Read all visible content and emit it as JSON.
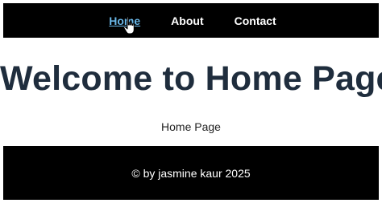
{
  "nav": {
    "items": [
      {
        "label": "Home"
      },
      {
        "label": "About"
      },
      {
        "label": "Contact"
      }
    ],
    "active_color": "#6ab7e8",
    "background": "#000000"
  },
  "main": {
    "title": "Welcome to Home Page",
    "subtitle": "Home Page",
    "title_color": "#1f2d3d"
  },
  "footer": {
    "text": "© by jasmine kaur 2025",
    "background": "#000000"
  },
  "cursor": {
    "icon": "hand-pointer-icon"
  }
}
